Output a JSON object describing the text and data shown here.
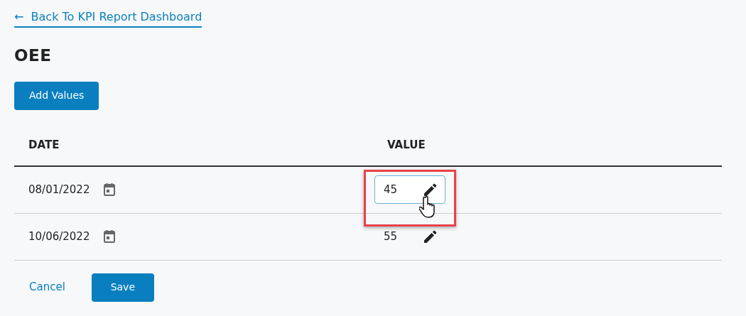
{
  "back_link": {
    "arrow": "←",
    "label": "Back To KPI Report Dashboard"
  },
  "title": "OEE",
  "add_button": "Add Values",
  "table": {
    "columns": [
      "DATE",
      "VALUE"
    ],
    "rows": [
      {
        "date": "08/01/2022",
        "value": "45",
        "editing": true,
        "highlighted": true
      },
      {
        "date": "10/06/2022",
        "value": "55",
        "editing": false,
        "highlighted": false
      }
    ]
  },
  "buttons": {
    "cancel": "Cancel",
    "save": "Save"
  }
}
